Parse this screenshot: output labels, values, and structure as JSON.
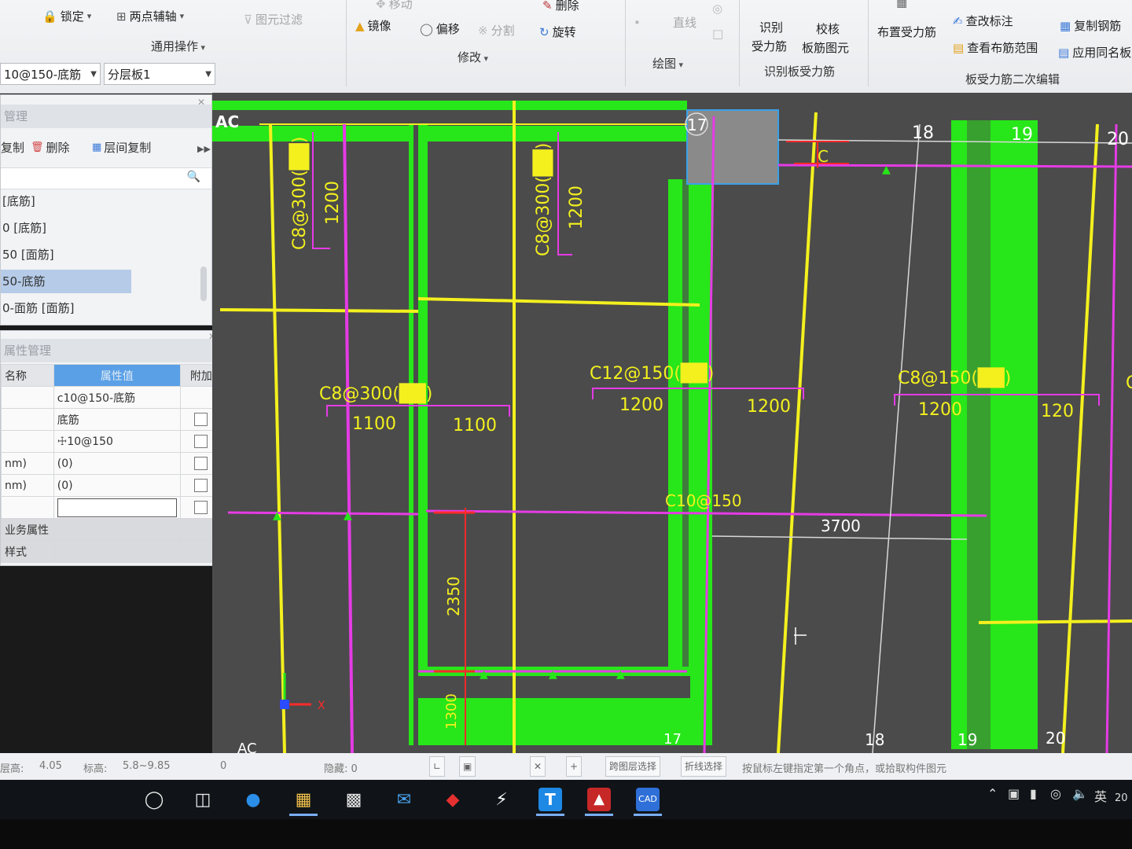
{
  "ribbon": {
    "lock_label": "锁定",
    "two_point_axis_label": "两点辅轴",
    "filter_label": "图元过滤",
    "general_ops_label": "通用操作",
    "move_label": "移动",
    "delete_label": "删除",
    "mirror_label": "镜像",
    "offset_label": "偏移",
    "split_label": "分割",
    "rotate_label": "旋转",
    "modify_label": "修改",
    "line_label": "直线",
    "draw_label": "绘图",
    "identify_label": "识别",
    "stress_bar_label": "受力筋",
    "check_label": "校核",
    "slab_bar_element_label": "板筋图元",
    "identify_slab_stress_label": "识别板受力筋",
    "layout_stress_label": "布置受力筋",
    "edit_annotation_label": "查改标注",
    "view_range_label": "查看布筋范围",
    "copy_bar_label": "复制钢筋",
    "apply_same_name_label": "应用同名板",
    "slab_stress_secondary_edit_label": "板受力筋二次编辑"
  },
  "selectors": {
    "element_value": "10@150-底筋",
    "layer_value": "分层板1"
  },
  "component_panel": {
    "title": "管理",
    "copy_label": "复制",
    "delete_label": "删除",
    "floor_copy_label": "层间复制",
    "items": [
      {
        "label": "[底筋]"
      },
      {
        "label": "0 [底筋]"
      },
      {
        "label": "50 [面筋]"
      },
      {
        "label": "50-底筋"
      },
      {
        "label": "0-面筋 [面筋]"
      }
    ]
  },
  "property_panel": {
    "title": "属性管理",
    "header_name": "名称",
    "header_value": "属性值",
    "header_extra": "附加",
    "rows": [
      {
        "name": "",
        "value": "c10@150-底筋"
      },
      {
        "name": "",
        "value": "底筋"
      },
      {
        "name": "",
        "value": "☩10@150"
      },
      {
        "name": "nm)",
        "value": "(0)"
      },
      {
        "name": "nm)",
        "value": "(0)"
      },
      {
        "name": "",
        "value": ""
      },
      {
        "name": "业务属性",
        "value": ""
      },
      {
        "name": "样式",
        "value": ""
      }
    ]
  },
  "drawing": {
    "axis_labels": [
      "AC",
      "17",
      "18",
      "19",
      "20"
    ],
    "bottom_axis_labels": [
      "AC",
      "17",
      "18",
      "19",
      "20"
    ],
    "texts": {
      "c8_300_a": "C8@300(██)",
      "c8_300_b": "C8@300(██)",
      "c8_300_c": "C8@300(██)",
      "c12_150": "C12@150(██)",
      "c8_150": "C8@150(██)",
      "c10_150": "C10@150",
      "d1200_a": "1200",
      "d1200_b": "1200",
      "d1100_a": "1100",
      "d1100_b": "1100",
      "d1200_c": "1200",
      "d1200_d": "1200",
      "d1200_e": "1200",
      "d1200_f": "120",
      "d3700": "3700",
      "d2350": "2350",
      "d1300": "1300",
      "c_tag": "C",
      "x_axis": "X",
      "c_partial": "C"
    },
    "colors": {
      "background": "#4b4b4b",
      "beam": "#27e619",
      "yellow": "#f3f01e",
      "magenta": "#e53be5",
      "red": "#ff2a2a"
    }
  },
  "status": {
    "floor_height_label": "层高:",
    "floor_height_value": "4.05",
    "elevation_label": "标高:",
    "elevation_value": "5.8~9.85",
    "zero_value": "0",
    "hidden_label": "隐藏: 0",
    "cross_layer_select": "跨图层选择",
    "polyline_select": "折线选择",
    "hint": "按鼠标左键指定第一个角点，或拾取构件图元"
  },
  "taskbar": {
    "ime_label": "英",
    "clock_partial": "20"
  }
}
